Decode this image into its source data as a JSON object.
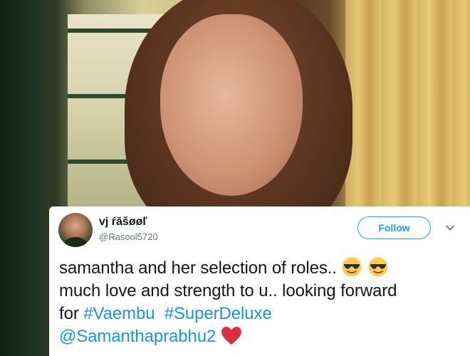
{
  "tweet": {
    "author_name": "vj ŕăšøøľ",
    "author_handle": "@Rasool5720",
    "follow_label": "Follow",
    "line1_text": "samantha and her selection of roles..",
    "line2_text": "much love and strength to u.. looking forward",
    "line3_prefix": "for",
    "hashtag1": "#Vaembu",
    "hashtag2": "#SuperDeluxe",
    "mention": "@Samanthaprabhu2",
    "emojis": [
      "sunglasses-face",
      "sunglasses-face",
      "red-heart"
    ]
  },
  "colors": {
    "link": "#1b95e0",
    "follow_border": "#1da1f2",
    "handle": "#657786",
    "text": "#14171a",
    "heart": "#e0245e"
  }
}
